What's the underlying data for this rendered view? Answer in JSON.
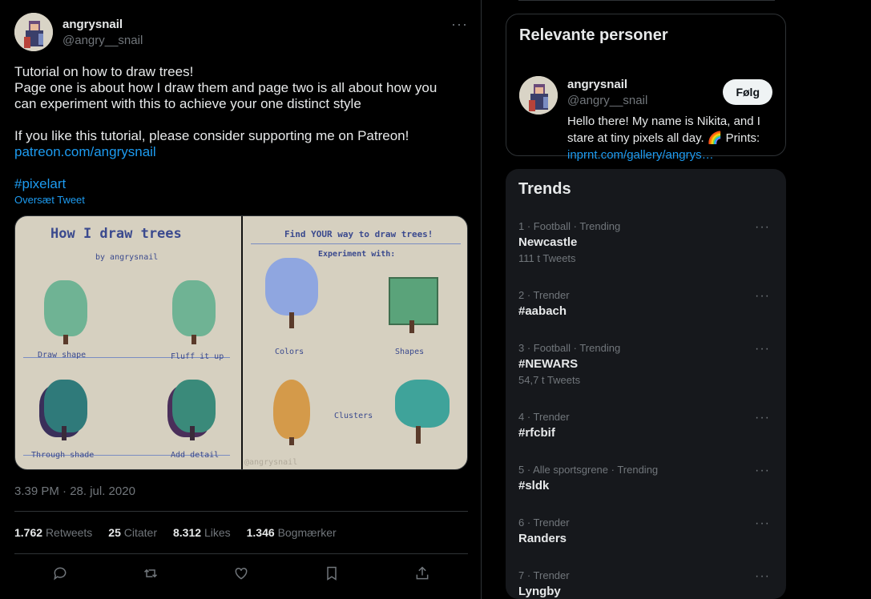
{
  "tweet": {
    "author_name": "angrysnail",
    "author_handle": "@angry__snail",
    "more_label": "···",
    "lines": [
      "Tutorial on how to draw trees!",
      "Page one is about how I draw them and page two is all about how you",
      "can experiment with this to achieve your one distinct style",
      "",
      "If you like this tutorial, please consider supporting me on Patreon!"
    ],
    "link": "patreon.com/angrysnail",
    "hashtag": "#pixelart",
    "translate": "Oversæt Tweet",
    "media": {
      "left_title": "How I draw trees",
      "left_by": "by angrysnail",
      "left_labels": [
        "Draw shape",
        "Fluff it up",
        "Through shade",
        "Add detail"
      ],
      "right_title": "Find YOUR way to draw trees!",
      "right_sub": "Experiment with:",
      "right_labels": [
        "Colors",
        "Shapes",
        "Clusters"
      ],
      "watermark": "@angrysnail"
    },
    "timestamp": "3.39 PM · 28. jul. 2020",
    "stats": {
      "retweets_count": "1.762",
      "retweets_label": "Retweets",
      "quotes_count": "25",
      "quotes_label": "Citater",
      "likes_count": "8.312",
      "likes_label": "Likes",
      "bookmarks_count": "1.346",
      "bookmarks_label": "Bogmærker"
    }
  },
  "people": {
    "title": "Relevante personer",
    "name": "angrysnail",
    "handle": "@angry__snail",
    "follow_label": "Følg",
    "bio_text": "Hello there! My name is Nikita, and I stare at tiny pixels all day. 🌈 Prints:",
    "bio_link": "inprnt.com/gallery/angrys…"
  },
  "trends": {
    "title": "Trends",
    "items": [
      {
        "meta": "1 · Football · Trending",
        "name": "Newcastle",
        "count": "111 t Tweets"
      },
      {
        "meta": "2 · Trender",
        "name": "#aabach",
        "count": ""
      },
      {
        "meta": "3 · Football · Trending",
        "name": "#NEWARS",
        "count": "54,7 t Tweets"
      },
      {
        "meta": "4 · Trender",
        "name": "#rfcbif",
        "count": ""
      },
      {
        "meta": "5 · Alle sportsgrene · Trending",
        "name": "#sldk",
        "count": ""
      },
      {
        "meta": "6 · Trender",
        "name": "Randers",
        "count": ""
      },
      {
        "meta": "7 · Trender",
        "name": "Lyngby",
        "count": ""
      }
    ]
  }
}
